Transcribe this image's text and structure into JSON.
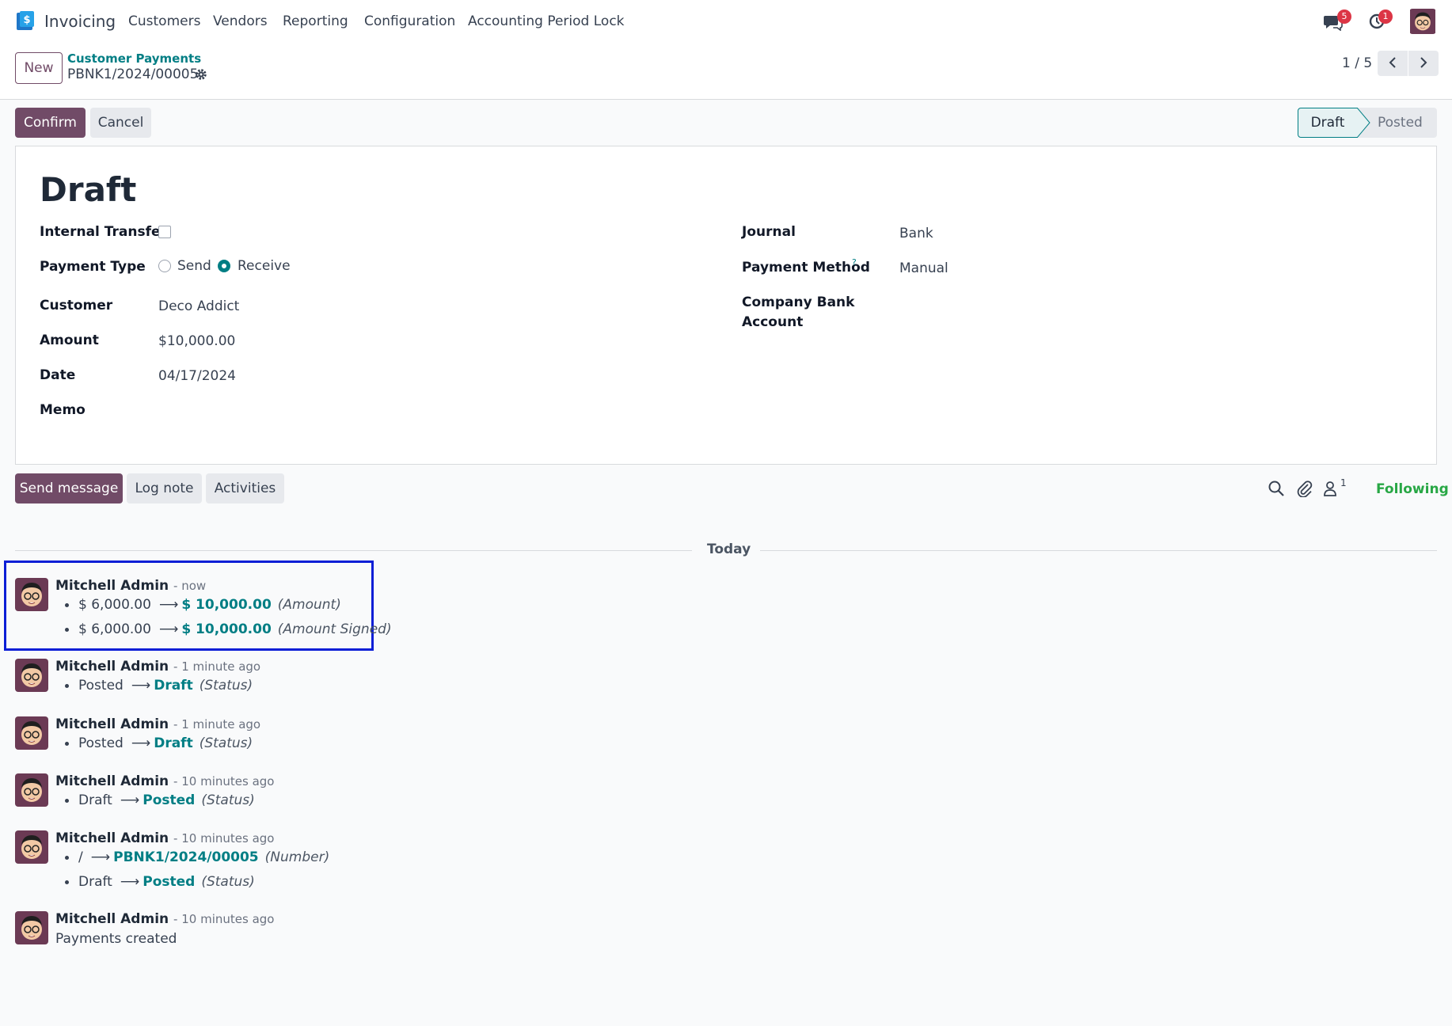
{
  "navbar": {
    "app_name": "Invoicing",
    "menu": [
      "Customers",
      "Vendors",
      "Reporting",
      "Configuration",
      "Accounting Period Lock"
    ],
    "messages_count": "5",
    "activities_count": "1",
    "accent": "#714b67"
  },
  "control": {
    "new_label": "New",
    "breadcrumb": "Customer Payments",
    "record_name": "PBNK1/2024/00005",
    "pager": "1 / 5"
  },
  "statusbar": {
    "confirm_label": "Confirm",
    "cancel_label": "Cancel",
    "stages": [
      "Draft",
      "Posted"
    ],
    "active_stage": "Draft"
  },
  "form": {
    "title": "Draft",
    "internal_transfer_label": "Internal Transfer",
    "payment_type_label": "Payment Type",
    "payment_type_options": [
      "Send",
      "Receive"
    ],
    "payment_type_selected": "Receive",
    "customer_label": "Customer",
    "customer_value": "Deco Addict",
    "amount_label": "Amount",
    "amount_value": "$10,000.00",
    "date_label": "Date",
    "date_value": "04/17/2024",
    "memo_label": "Memo",
    "journal_label": "Journal",
    "journal_value": "Bank",
    "payment_method_label": "Payment Method",
    "payment_method_help": "?",
    "payment_method_value": "Manual",
    "company_bank_label_1": "Company Bank",
    "company_bank_label_2": "Account"
  },
  "chatter": {
    "send_message_label": "Send message",
    "log_note_label": "Log note",
    "activities_label": "Activities",
    "followers_count": "1",
    "following_label": "Following",
    "separator": "Today",
    "messages": [
      {
        "author": "Mitchell Admin",
        "when": "- now",
        "lines": [
          {
            "old": "$ 6,000.00",
            "new": "$ 10,000.00",
            "field": "(Amount)"
          },
          {
            "old": "$ 6,000.00",
            "new": "$ 10,000.00",
            "field": "(Amount Signed)"
          }
        ]
      },
      {
        "author": "Mitchell Admin",
        "when": "- 1 minute ago",
        "lines": [
          {
            "old": "Posted",
            "new": "Draft",
            "field": "(Status)"
          }
        ]
      },
      {
        "author": "Mitchell Admin",
        "when": "- 1 minute ago",
        "lines": [
          {
            "old": "Posted",
            "new": "Draft",
            "field": "(Status)"
          }
        ]
      },
      {
        "author": "Mitchell Admin",
        "when": "- 10 minutes ago",
        "lines": [
          {
            "old": "Draft",
            "new": "Posted",
            "field": "(Status)"
          }
        ]
      },
      {
        "author": "Mitchell Admin",
        "when": "- 10 minutes ago",
        "lines": [
          {
            "old": "/",
            "new": "PBNK1/2024/00005",
            "field": "(Number)"
          },
          {
            "old": "Draft",
            "new": "Posted",
            "field": "(Status)"
          }
        ]
      },
      {
        "author": "Mitchell Admin",
        "when": "- 10 minutes ago",
        "body": "Payments created"
      }
    ]
  }
}
